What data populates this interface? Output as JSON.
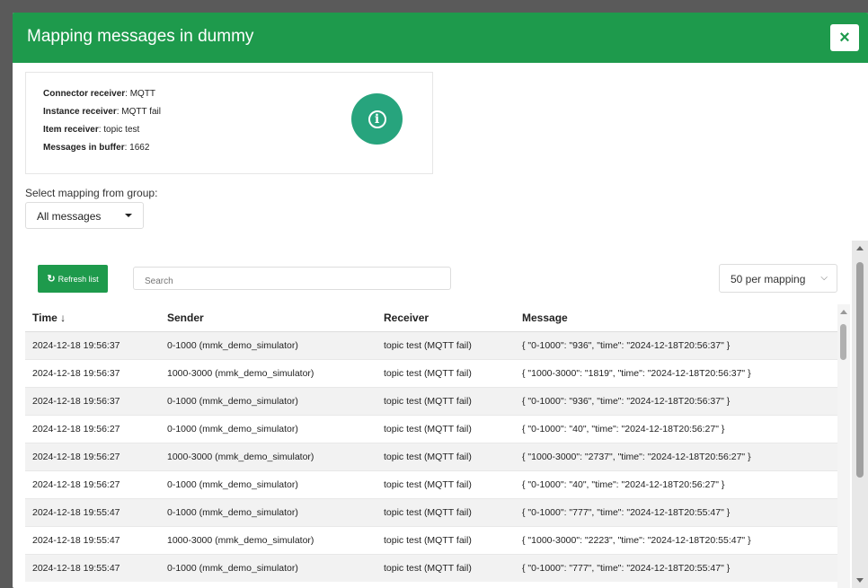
{
  "modal": {
    "title": "Mapping messages in dummy",
    "close_icon": "×"
  },
  "info": {
    "connector_label": "Connector receiver",
    "connector_value": ": MQTT",
    "instance_label": "Instance receiver",
    "instance_value": ": MQTT fail",
    "item_label": "Item receiver",
    "item_value": ": topic test",
    "buffer_label": "Messages in buffer",
    "buffer_value": ": 1662",
    "icon_glyph": "i"
  },
  "group": {
    "label": "Select mapping from group:",
    "selected": "All messages"
  },
  "toolbar": {
    "refresh_icon": "↻",
    "refresh_label": "Refresh list",
    "search_placeholder": "Search",
    "perpage_selected": "50 per mapping",
    "perpage_chevron": "⌵"
  },
  "table": {
    "columns": [
      "Time ↓",
      "Sender",
      "Receiver",
      "Message"
    ],
    "rows": [
      [
        "2024-12-18 19:56:37",
        "0-1000 (mmk_demo_simulator)",
        "topic test (MQTT fail)",
        "{ \"0-1000\": \"936\", \"time\": \"2024-12-18T20:56:37\" }"
      ],
      [
        "2024-12-18 19:56:37",
        "1000-3000 (mmk_demo_simulator)",
        "topic test (MQTT fail)",
        "{ \"1000-3000\": \"1819\", \"time\": \"2024-12-18T20:56:37\" }"
      ],
      [
        "2024-12-18 19:56:37",
        "0-1000 (mmk_demo_simulator)",
        "topic test (MQTT fail)",
        "{ \"0-1000\": \"936\", \"time\": \"2024-12-18T20:56:37\" }"
      ],
      [
        "2024-12-18 19:56:27",
        "0-1000 (mmk_demo_simulator)",
        "topic test (MQTT fail)",
        "{ \"0-1000\": \"40\", \"time\": \"2024-12-18T20:56:27\" }"
      ],
      [
        "2024-12-18 19:56:27",
        "1000-3000 (mmk_demo_simulator)",
        "topic test (MQTT fail)",
        "{ \"1000-3000\": \"2737\", \"time\": \"2024-12-18T20:56:27\" }"
      ],
      [
        "2024-12-18 19:56:27",
        "0-1000 (mmk_demo_simulator)",
        "topic test (MQTT fail)",
        "{ \"0-1000\": \"40\", \"time\": \"2024-12-18T20:56:27\" }"
      ],
      [
        "2024-12-18 19:55:47",
        "0-1000 (mmk_demo_simulator)",
        "topic test (MQTT fail)",
        "{ \"0-1000\": \"777\", \"time\": \"2024-12-18T20:55:47\" }"
      ],
      [
        "2024-12-18 19:55:47",
        "1000-3000 (mmk_demo_simulator)",
        "topic test (MQTT fail)",
        "{ \"1000-3000\": \"2223\", \"time\": \"2024-12-18T20:55:47\" }"
      ],
      [
        "2024-12-18 19:55:47",
        "0-1000 (mmk_demo_simulator)",
        "topic test (MQTT fail)",
        "{ \"0-1000\": \"777\", \"time\": \"2024-12-18T20:55:47\" }"
      ]
    ]
  },
  "colors": {
    "header": "#1e9a4c",
    "info_icon": "#27a47d",
    "row_alt": "#f2f2f2"
  }
}
